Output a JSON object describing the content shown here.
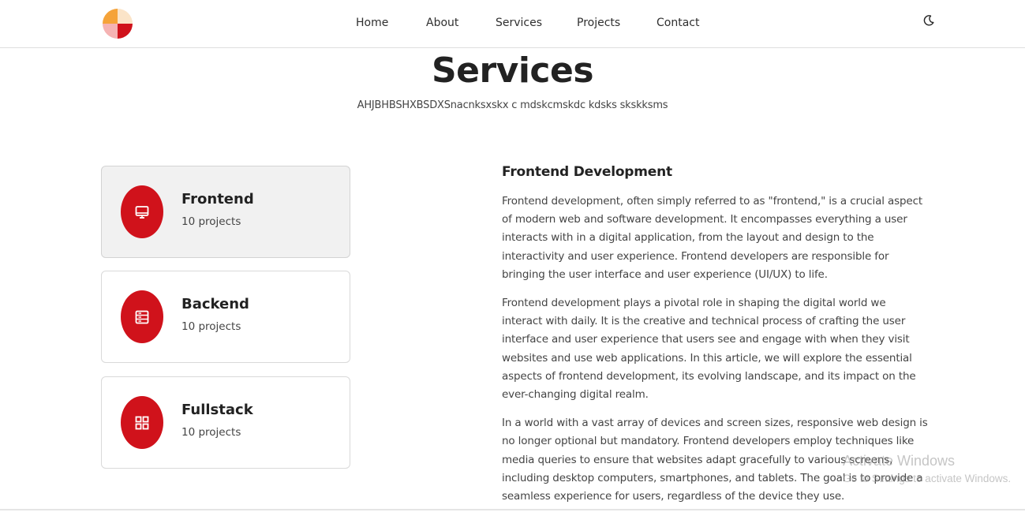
{
  "nav": {
    "items": [
      {
        "label": "Home"
      },
      {
        "label": "About"
      },
      {
        "label": "Services"
      },
      {
        "label": "Projects"
      },
      {
        "label": "Contact"
      }
    ],
    "theme_icon": "moon-icon"
  },
  "logo": {
    "colors": [
      "#f5a339",
      "#fbe4c8",
      "#f5b3b3",
      "#d0121b"
    ]
  },
  "hero": {
    "title": "Services",
    "subtitle": "AHJBHBSHXBSDXSnacnksxskx c mdskcmskdc kdsks skskksms"
  },
  "services": [
    {
      "title": "Frontend",
      "meta": "10 projects",
      "icon": "monitor-icon",
      "active": true
    },
    {
      "title": "Backend",
      "meta": "10 projects",
      "icon": "server-icon",
      "active": false
    },
    {
      "title": "Fullstack",
      "meta": "10 projects",
      "icon": "grid-icon",
      "active": false
    }
  ],
  "detail": {
    "heading": "Frontend Development",
    "paragraphs": [
      "Frontend development, often simply referred to as \"frontend,\" is a crucial aspect of modern web and software development. It encompasses everything a user interacts with in a digital application, from the layout and design to the interactivity and user experience. Frontend developers are responsible for bringing the user interface and user experience (UI/UX) to life.",
      "Frontend development plays a pivotal role in shaping the digital world we interact with daily. It is the creative and technical process of crafting the user interface and user experience that users see and engage with when they visit websites and use web applications. In this article, we will explore the essential aspects of frontend development, its evolving landscape, and its impact on the ever-changing digital realm.",
      "In a world with a vast array of devices and screen sizes, responsive web design is no longer optional but mandatory. Frontend developers employ techniques like media queries to ensure that websites adapt gracefully to various screens, including desktop computers, smartphones, and tablets. The goal is to provide a seamless experience for users, regardless of the device they use."
    ]
  },
  "watermark": {
    "line1": "Activate Windows",
    "line2": "Go to Settings to activate Windows."
  },
  "colors": {
    "accent": "#d0121b",
    "active_card_bg": "#f1f1f1"
  }
}
